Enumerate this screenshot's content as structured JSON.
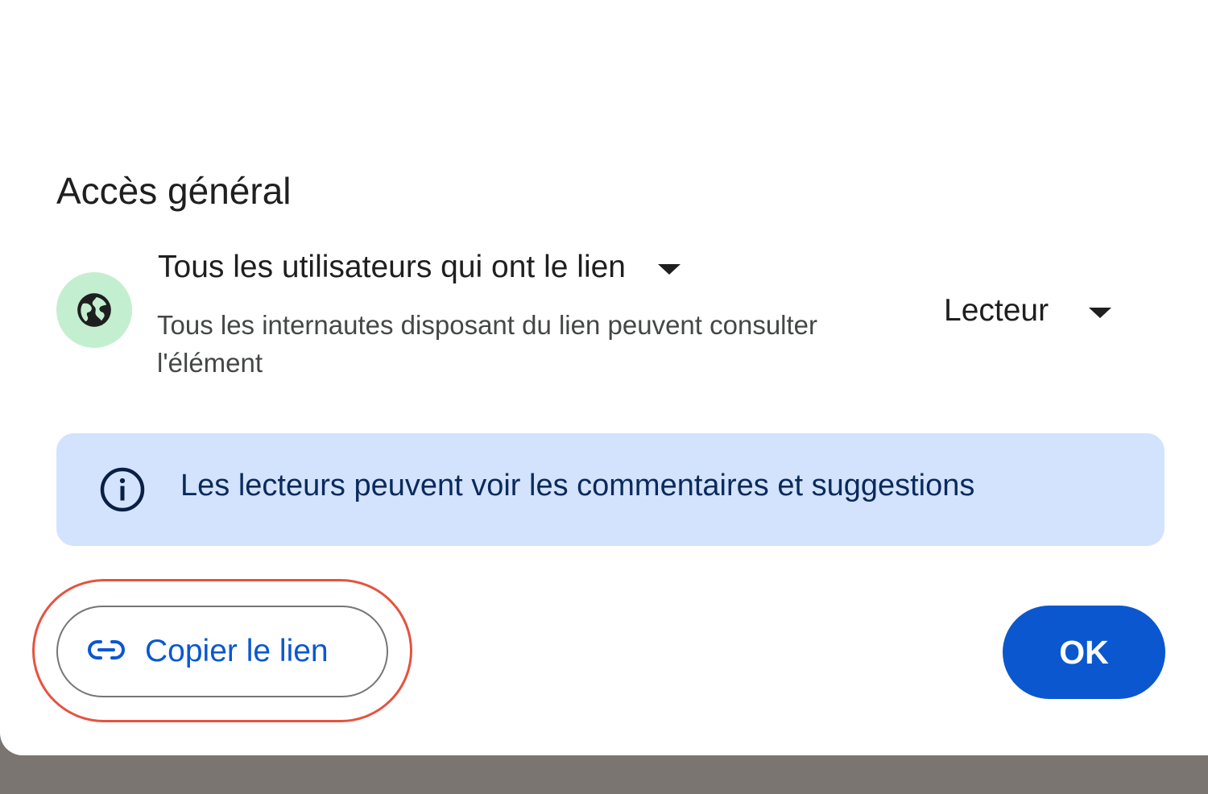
{
  "general_access": {
    "title": "Accès général",
    "access_option": "Tous les utilisateurs qui ont le lien",
    "access_description": "Tous les internautes disposant du lien peuvent consulter l'élément",
    "role": "Lecteur",
    "icon": "globe-icon"
  },
  "info_banner": {
    "text": "Les lecteurs peuvent voir les commentaires et suggestions",
    "icon": "info-icon"
  },
  "footer": {
    "copy_link_label": "Copier le lien",
    "copy_link_icon": "link-icon",
    "ok_label": "OK"
  },
  "colors": {
    "primary": "#0b57d0",
    "info_background": "#d3e3fd",
    "globe_background": "#c4eed0",
    "highlight": "#e5533f"
  }
}
